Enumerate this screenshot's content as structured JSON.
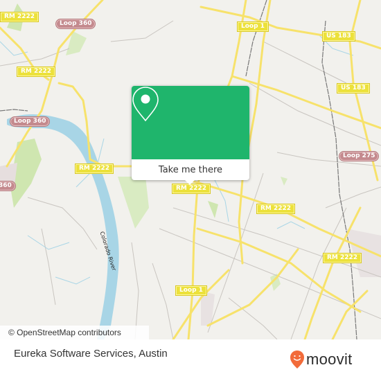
{
  "map": {
    "road_labels": [
      {
        "id": "rm2222-a",
        "text": "RM 2222",
        "style": "yellow"
      },
      {
        "id": "loop360-a",
        "text": "Loop 360",
        "style": "loop360"
      },
      {
        "id": "rm2222-b",
        "text": "RM 2222",
        "style": "yellow"
      },
      {
        "id": "loop360-b",
        "text": "Loop 360",
        "style": "loop360"
      },
      {
        "id": "loop360-c",
        "text": "360",
        "style": "loop360"
      },
      {
        "id": "rm2222-c",
        "text": "RM 2222",
        "style": "yellow"
      },
      {
        "id": "loop1-a",
        "text": "Loop 1",
        "style": "yellow"
      },
      {
        "id": "us183-a",
        "text": "US 183",
        "style": "yellow"
      },
      {
        "id": "us183-b",
        "text": "US 183",
        "style": "yellow"
      },
      {
        "id": "loop275",
        "text": "Loop 275",
        "style": "loop360"
      },
      {
        "id": "rm2222-d",
        "text": "RM 2222",
        "style": "yellow"
      },
      {
        "id": "rm2222-e",
        "text": "RM 2222",
        "style": "yellow"
      },
      {
        "id": "rm2222-f",
        "text": "RM 2222",
        "style": "yellow"
      },
      {
        "id": "loop1-b",
        "text": "Loop 1",
        "style": "yellow"
      }
    ],
    "river_label": "Colorado River",
    "attribution": "© OpenStreetMap contributors"
  },
  "popup": {
    "icon": "map-pin-icon",
    "button_label": "Take me there",
    "accent": "#1fb56c"
  },
  "footer": {
    "place_name": "Eureka Software Services, Austin",
    "logo_text": "moovit",
    "logo_color": "#f26b3a"
  }
}
